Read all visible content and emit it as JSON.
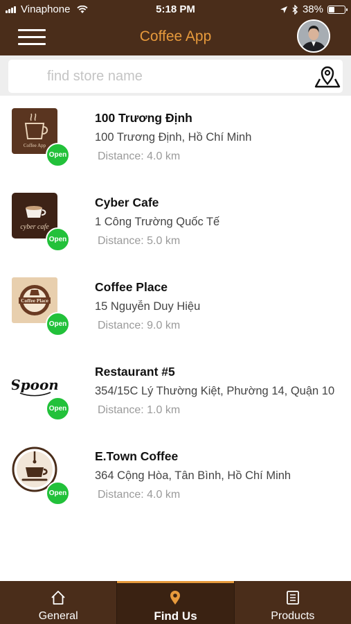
{
  "status_bar": {
    "carrier": "Vinaphone",
    "time": "5:18 PM",
    "battery_text": "38%",
    "battery_level": 0.38,
    "icons": [
      "signal-icon",
      "wifi-icon",
      "location-arrow-icon",
      "bluetooth-icon",
      "battery-icon"
    ]
  },
  "header": {
    "title": "Coffee App",
    "title_color": "#e79a3c",
    "background_color": "#4a2d1a"
  },
  "search": {
    "placeholder": "find store name",
    "value": ""
  },
  "stores": [
    {
      "name": "100 Trương Định",
      "address": "100 Trương Định, Hồ Chí Minh",
      "distance": "Distance: 4.0 km",
      "status": "Open",
      "logo": "coffee-app-logo",
      "logo_text": "Coffee App"
    },
    {
      "name": "Cyber Cafe",
      "address": "1 Công Trường Quốc Tế",
      "distance": "Distance: 5.0 km",
      "status": "Open",
      "logo": "cyber-cafe-logo",
      "logo_text": "cyber cafe"
    },
    {
      "name": "Coffee Place",
      "address": "15 Nguyễn Duy Hiệu",
      "distance": "Distance: 9.0 km",
      "status": "Open",
      "logo": "coffee-place-logo",
      "logo_text": "Coffee Place"
    },
    {
      "name": "Restaurant #5",
      "address": "354/15C Lý Thường Kiệt, Phường 14, Quận 10",
      "distance": "Distance: 1.0 km",
      "status": "Open",
      "logo": "spoon-logo",
      "logo_text": "Spoon"
    },
    {
      "name": "E.Town Coffee",
      "address": "364 Cộng Hòa, Tân Bình, Hồ Chí Minh",
      "distance": "Distance: 4.0 km",
      "status": "Open",
      "logo": "etown-coffee-logo",
      "logo_text": ""
    }
  ],
  "tabs": [
    {
      "label": "General",
      "icon": "home-icon",
      "active": false
    },
    {
      "label": "Find Us",
      "icon": "map-pin-icon",
      "active": true
    },
    {
      "label": "Products",
      "icon": "list-icon",
      "active": false
    }
  ],
  "colors": {
    "accent": "#e79a3c",
    "brand_brown": "#4a2d1a",
    "open_green": "#22c13a"
  }
}
